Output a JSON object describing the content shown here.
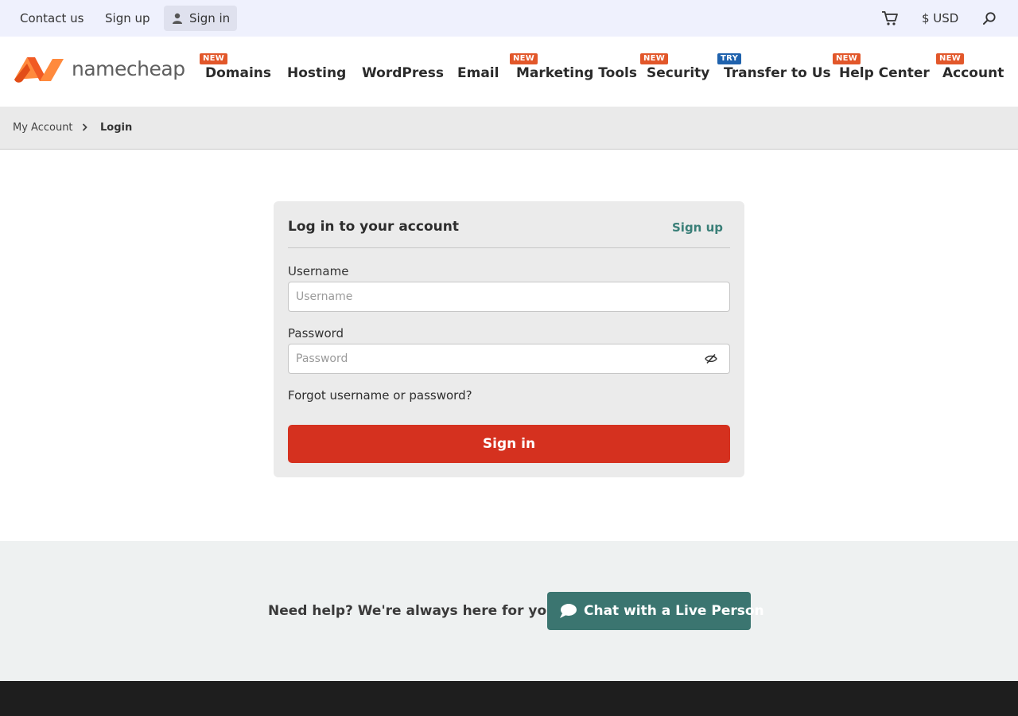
{
  "topbar": {
    "contact_label": "Contact us",
    "signup_label": "Sign up",
    "signin_label": "Sign in",
    "currency_label": "$ USD"
  },
  "logo": {
    "text": "namecheap"
  },
  "nav": {
    "items": [
      {
        "label": "Domains",
        "badge": "NEW"
      },
      {
        "label": "Hosting",
        "badge": ""
      },
      {
        "label": "WordPress",
        "badge": ""
      },
      {
        "label": "Email",
        "badge": ""
      },
      {
        "label": "Marketing Tools",
        "badge": "NEW"
      },
      {
        "label": "Security",
        "badge": "NEW"
      },
      {
        "label": "Transfer to Us",
        "badge": "TRY ME"
      },
      {
        "label": "Help Center",
        "badge": "NEW"
      },
      {
        "label": "Account",
        "badge": "NEW"
      }
    ]
  },
  "breadcrumb": {
    "parent": "My Account",
    "current": "Login"
  },
  "login": {
    "title": "Log in to your account",
    "signup_link": "Sign up",
    "username_label": "Username",
    "username_placeholder": "Username",
    "username_value": "",
    "password_label": "Password",
    "password_placeholder": "Password",
    "password_value": "",
    "forgot_link": "Forgot username or password?",
    "submit_label": "Sign in"
  },
  "help": {
    "text": "Need help? We're always here for you.",
    "chat_label": "Chat with a Live Person"
  },
  "colors": {
    "brand_orange": "#f15a24",
    "signin_red": "#d5311f",
    "teal": "#3b7570",
    "badge_new": "#e2572a",
    "badge_try": "#1f62ad"
  }
}
